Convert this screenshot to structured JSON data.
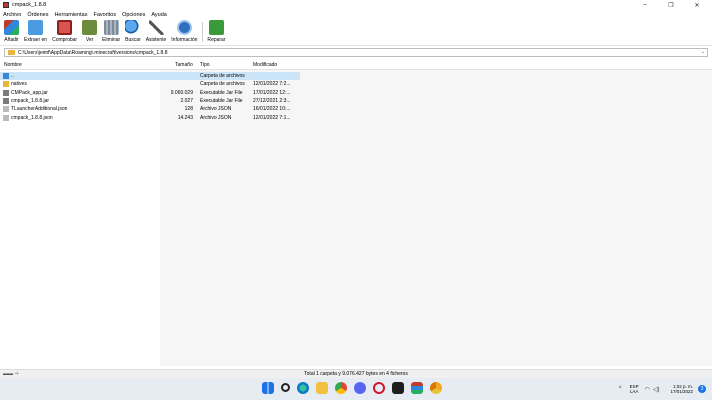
{
  "window": {
    "title": "cmpack_1.8.8",
    "minimize": "–",
    "maximize": "❐",
    "close": "✕"
  },
  "menu": [
    "Archivo",
    "Órdenes",
    "Herramientas",
    "Favoritos",
    "Opciones",
    "Ayuda"
  ],
  "toolbar": {
    "add": "Añadir",
    "extract": "Extraer en",
    "test": "Comprobar",
    "view": "Ver",
    "delete": "Eliminar",
    "find": "Buscar",
    "wizard": "Asistente",
    "info": "Información",
    "repair": "Reparar"
  },
  "address": {
    "path": "C:\\Users\\jeimf\\AppData\\Roaming\\.minecraft\\versions\\cmpack_1.8.8",
    "chevron": "⌄"
  },
  "columns": {
    "name": "Nombre",
    "size": "Tamaño",
    "type": "Tipo",
    "modified": "Modificado"
  },
  "files": [
    {
      "name": "..",
      "size": "",
      "type": "Carpeta de archivos",
      "modified": "",
      "icon": "up-folder",
      "color": "#3a86d6"
    },
    {
      "name": "natives",
      "size": "",
      "type": "Carpeta de archivos",
      "modified": "12/01/2022 7:2...",
      "icon": "folder",
      "color": "#e8b83e"
    },
    {
      "name": "CMPack_app.jar",
      "size": "9.060.029",
      "type": "Executable Jar File",
      "modified": "17/01/2022 12:...",
      "icon": "jar",
      "color": "#7a7a7a"
    },
    {
      "name": "cmpack_1.8.8.jar",
      "size": "2.027",
      "type": "Executable Jar File",
      "modified": "27/12/2021 2:3...",
      "icon": "jar",
      "color": "#7a7a7a"
    },
    {
      "name": "TLauncherAdditional.json",
      "size": "128",
      "type": "Archivo JSON",
      "modified": "16/01/2022 10:...",
      "icon": "json",
      "color": "#bbbbbb"
    },
    {
      "name": "cmpack_1.8.8.json",
      "size": "14.243",
      "type": "Archivo JSON",
      "modified": "12/01/2022 7:1...",
      "icon": "json",
      "color": "#bbbbbb"
    }
  ],
  "status": {
    "text": "Total 1 carpeta y 9.076.427 bytes en 4 ficheros",
    "icons": "▬▬ ⇒"
  },
  "taskbar": {
    "icons": [
      "windows-start",
      "search",
      "edge",
      "file-explorer",
      "chrome",
      "discord",
      "opera",
      "terminal",
      "winrar",
      "chrome-canary"
    ],
    "lang_top": "ESP",
    "lang_bottom": "LAA",
    "time": "1:02 p. m.",
    "date": "17/01/2022",
    "notifications": "3"
  }
}
